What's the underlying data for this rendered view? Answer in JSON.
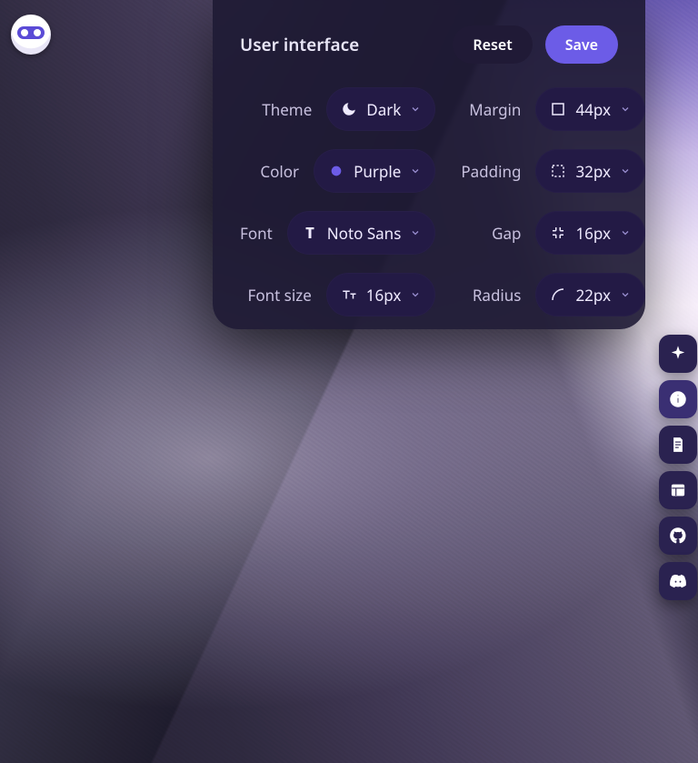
{
  "panel": {
    "title": "User interface",
    "reset_label": "Reset",
    "save_label": "Save"
  },
  "settings": {
    "left": [
      {
        "label": "Theme",
        "value": "Dark",
        "icon": "moon"
      },
      {
        "label": "Color",
        "value": "Purple",
        "icon": "dot-purple"
      },
      {
        "label": "Font",
        "value": "Noto Sans",
        "icon": "font"
      },
      {
        "label": "Font size",
        "value": "16px",
        "icon": "font-size"
      }
    ],
    "right": [
      {
        "label": "Margin",
        "value": "44px",
        "icon": "margin"
      },
      {
        "label": "Padding",
        "value": "32px",
        "icon": "padding"
      },
      {
        "label": "Gap",
        "value": "16px",
        "icon": "gap"
      },
      {
        "label": "Radius",
        "value": "22px",
        "icon": "radius"
      }
    ]
  },
  "colors": {
    "accent": "#6c5ce7",
    "pill_bg": "#231a45",
    "panel_bg": "rgba(30,26,52,0.92)"
  },
  "sidebar_icons": [
    "sparkle",
    "info",
    "document",
    "layout",
    "github",
    "discord"
  ]
}
